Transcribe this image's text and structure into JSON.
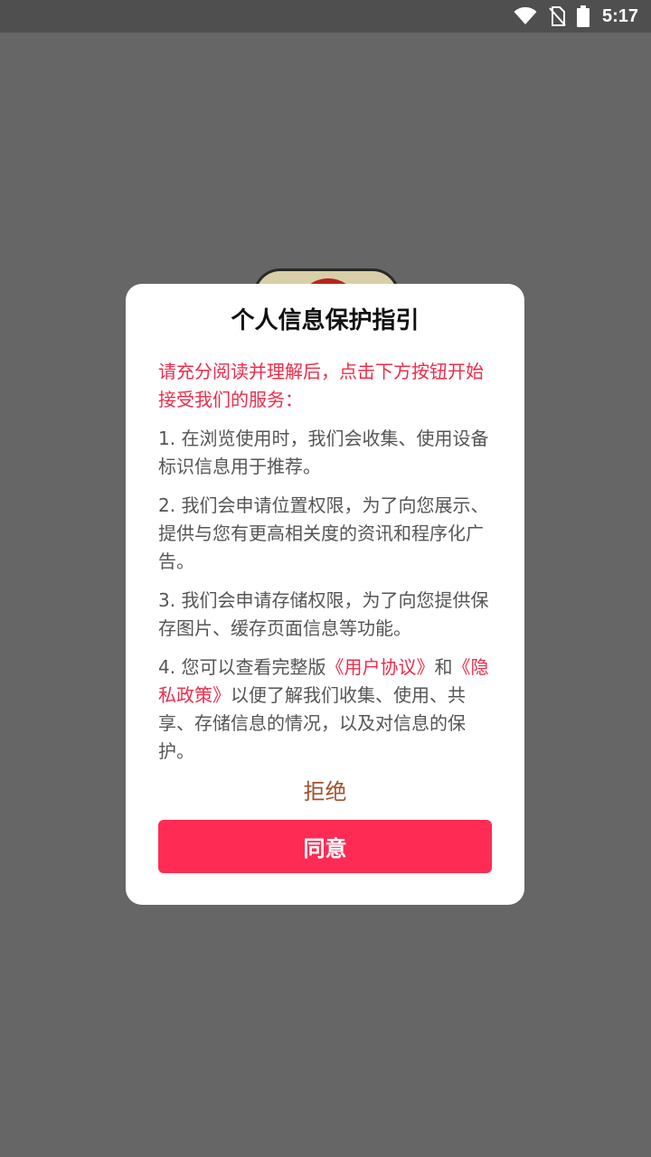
{
  "status_bar": {
    "time": "5:17",
    "icons": [
      "wifi-icon",
      "no-sim-icon",
      "battery-icon"
    ]
  },
  "dialog": {
    "title": "个人信息保护指引",
    "intro": "请充分阅读并理解后，点击下方按钮开始接受我们的服务：",
    "items": [
      {
        "text": "1. 在浏览使用时，我们会收集、使用设备标识信息用于推荐。"
      },
      {
        "text": "2. 我们会申请位置权限，为了向您展示、提供与您有更高相关度的资讯和程序化广告。"
      },
      {
        "text": "3. 我们会申请存储权限，为了向您提供保存图片、缓存页面信息等功能。"
      }
    ],
    "item4": {
      "prefix": "4. 您可以查看完整版",
      "user_agreement": "《用户协议》",
      "and": "和",
      "privacy_policy": "《隐私政策》",
      "suffix": "以便了解我们收集、使用、共享、存储信息的情况，以及对信息的保护。"
    },
    "reject_label": "拒绝",
    "agree_label": "同意"
  },
  "colors": {
    "accent": "#fe2c55",
    "link": "#ee2c4a",
    "reject": "#a0522d",
    "overlay": "#666666"
  }
}
